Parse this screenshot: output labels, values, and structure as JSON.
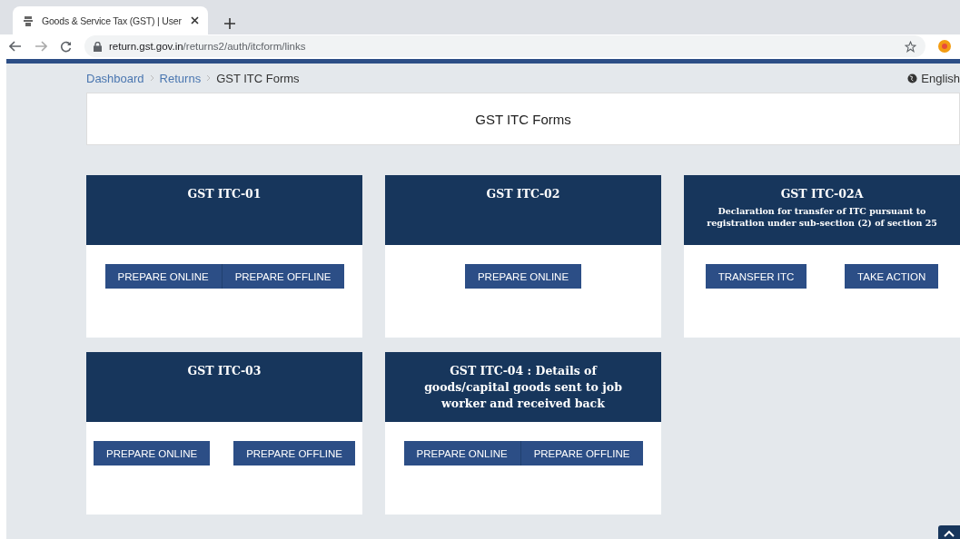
{
  "browser": {
    "tab_title": "Goods & Service Tax (GST) | User",
    "url_host": "return.gst.gov.in",
    "url_path": "/returns2/auth/itcform/links"
  },
  "breadcrumb": [
    {
      "label": "Dashboard",
      "kind": "link"
    },
    {
      "label": "Returns",
      "kind": "link"
    },
    {
      "label": "GST ITC Forms",
      "kind": "current"
    }
  ],
  "language": "English",
  "page_title": "GST ITC Forms",
  "cards": [
    {
      "title": "GST ITC-01",
      "joined": true,
      "buttons": [
        "PREPARE ONLINE",
        "PREPARE OFFLINE"
      ]
    },
    {
      "title": "GST ITC-02",
      "buttons": [
        "PREPARE ONLINE"
      ]
    },
    {
      "title": "GST ITC-02A",
      "subtitle": "Declaration for transfer of ITC pursuant to registration under sub-section (2) of section 25",
      "joined": false,
      "buttons": [
        "TRANSFER ITC",
        "TAKE ACTION"
      ]
    },
    {
      "title": "GST ITC-03",
      "joined": false,
      "buttons": [
        "PREPARE ONLINE",
        "PREPARE OFFLINE"
      ]
    },
    {
      "title": "GST ITC-04 : Details of goods/capital goods sent to job worker and received back",
      "joined": true,
      "buttons": [
        "PREPARE ONLINE",
        "PREPARE OFFLINE"
      ]
    }
  ]
}
